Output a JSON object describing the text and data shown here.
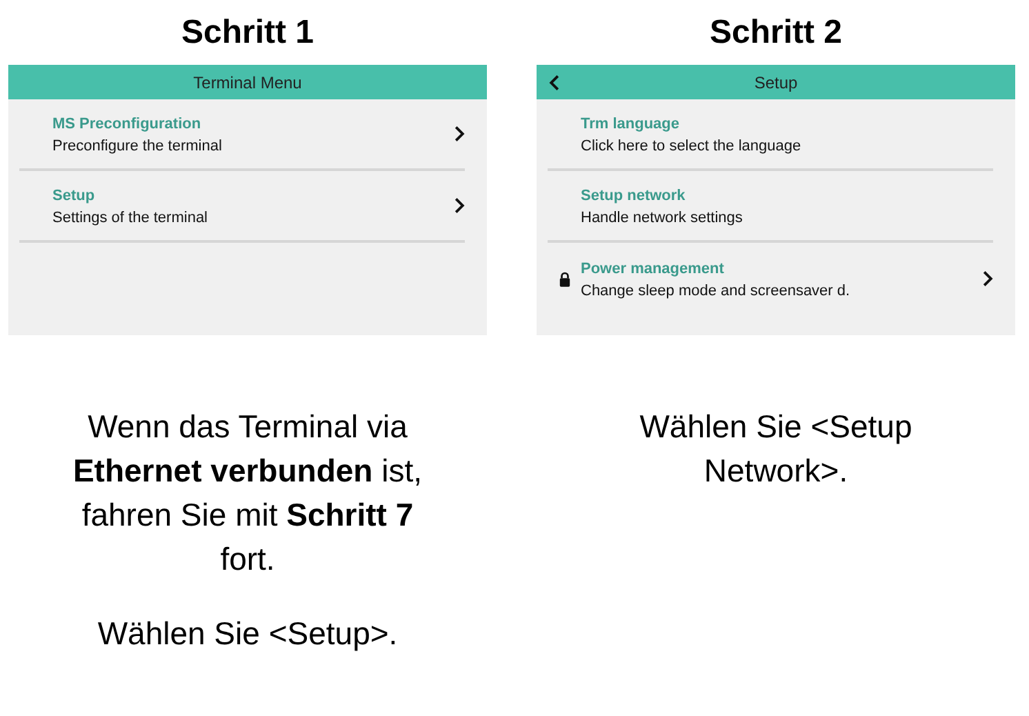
{
  "steps": [
    {
      "title": "Schritt 1",
      "screen": {
        "title": "Terminal Menu",
        "back": false,
        "items": [
          {
            "title": "MS Preconfiguration",
            "subtitle": "Preconfigure the terminal",
            "chevron": true,
            "locked": false,
            "divider": true
          },
          {
            "title": "Setup",
            "subtitle": "Settings of the terminal",
            "chevron": true,
            "locked": false,
            "divider": true
          }
        ]
      },
      "captions": [
        "Wenn das Terminal via **Ethernet verbunden** ist, fahren Sie mit **Schritt 7** fort.",
        "Wählen Sie <Setup>."
      ]
    },
    {
      "title": "Schritt 2",
      "screen": {
        "title": "Setup",
        "back": true,
        "items": [
          {
            "title": "Trm language",
            "subtitle": "Click here to select the language",
            "chevron": false,
            "locked": false,
            "divider": true
          },
          {
            "title": "Setup network",
            "subtitle": "Handle network settings",
            "chevron": false,
            "locked": false,
            "divider": true
          },
          {
            "title": "Power management",
            "subtitle": "Change sleep mode and screensaver d.",
            "chevron": true,
            "locked": true,
            "divider": false
          }
        ]
      },
      "captions": [
        "Wählen Sie <Setup Network>."
      ]
    }
  ]
}
